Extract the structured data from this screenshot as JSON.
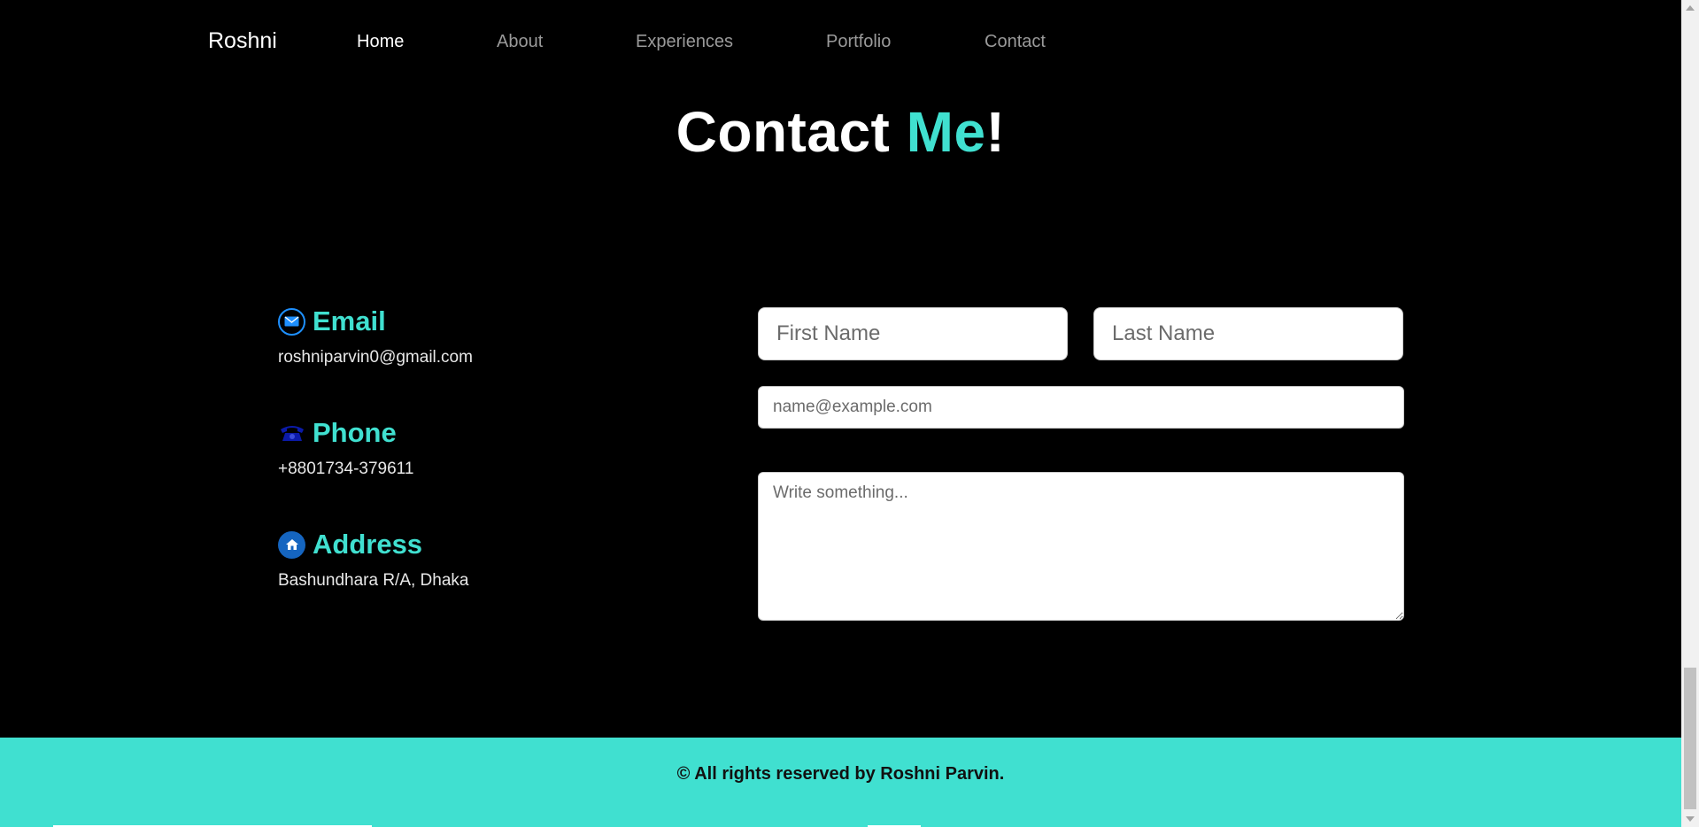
{
  "nav": {
    "brand": "Roshni",
    "links": [
      {
        "label": "Home",
        "active": true
      },
      {
        "label": "About",
        "active": false
      },
      {
        "label": "Experiences",
        "active": false
      },
      {
        "label": "Portfolio",
        "active": false
      },
      {
        "label": "Contact",
        "active": false
      }
    ]
  },
  "heading": {
    "part1": "Contact ",
    "accent": "Me",
    "part2": "!"
  },
  "contact_info": [
    {
      "icon": "envelope-icon",
      "label": "Email",
      "value": "roshniparvin0@gmail.com"
    },
    {
      "icon": "phone-icon",
      "label": "Phone",
      "value": "+8801734-379611"
    },
    {
      "icon": "home-icon",
      "label": "Address",
      "value": "Bashundhara R/A, Dhaka"
    }
  ],
  "form": {
    "first_name_placeholder": "First Name",
    "last_name_placeholder": "Last Name",
    "email_placeholder": "name@example.com",
    "message_placeholder": "Write something..."
  },
  "footer": {
    "text": "© All rights reserved by Roshni Parvin."
  },
  "colors": {
    "accent": "#40e0d0",
    "background": "#000000",
    "text": "#ffffff"
  }
}
